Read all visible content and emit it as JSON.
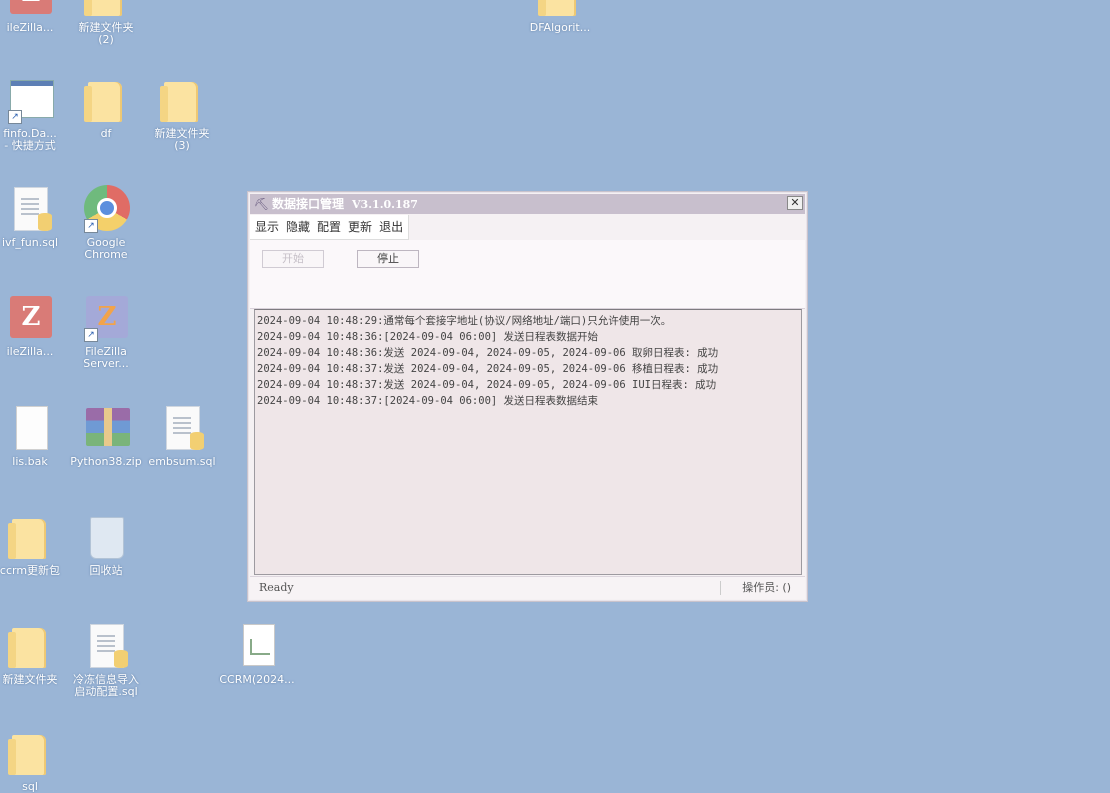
{
  "desktop": {
    "icons": [
      {
        "label": "ileZilla...",
        "type": "filezilla"
      },
      {
        "label": "新建文件夹\n(2)",
        "type": "folder"
      },
      {
        "label": "DFAlgorit...",
        "type": "folder"
      },
      {
        "label": "finfo.Da...\n- 快捷方式",
        "type": "app"
      },
      {
        "label": "df",
        "type": "folder"
      },
      {
        "label": "新建文件夹\n(3)",
        "type": "folder"
      },
      {
        "label": "ivf_fun.sql",
        "type": "sql"
      },
      {
        "label": "Google\nChrome",
        "type": "chrome"
      },
      {
        "label": "ileZilla...",
        "type": "filezilla"
      },
      {
        "label": "FileZilla\nServer...",
        "type": "filezilla-server"
      },
      {
        "label": "lis.bak",
        "type": "blank"
      },
      {
        "label": "Python38.zip",
        "type": "zip"
      },
      {
        "label": "embsum.sql",
        "type": "sql"
      },
      {
        "label": "ccrm更新包",
        "type": "folder"
      },
      {
        "label": "回收站",
        "type": "recycle"
      },
      {
        "label": "新建文件夹",
        "type": "folder"
      },
      {
        "label": "冷冻信息导入\n启动配置.sql",
        "type": "sql"
      },
      {
        "label": "CCRM(2024...",
        "type": "chart-doc"
      },
      {
        "label": "sql",
        "type": "folder"
      }
    ]
  },
  "window": {
    "title": "数据接口管理",
    "version": "V3.1.0.187",
    "close_symbol": "✕",
    "menu": [
      "显示",
      "隐藏",
      "配置",
      "更新",
      "退出"
    ],
    "buttons": {
      "start": "开始",
      "stop": "停止"
    },
    "log": [
      "2024-09-04 10:48:29:通常每个套接字地址(协议/网络地址/端口)只允许使用一次。",
      "2024-09-04 10:48:36:[2024-09-04 06:00] 发送日程表数据开始",
      "2024-09-04 10:48:36:发送 2024-09-04, 2024-09-05, 2024-09-06 取卵日程表: 成功",
      "2024-09-04 10:48:37:发送 2024-09-04, 2024-09-05, 2024-09-06 移植日程表: 成功",
      "2024-09-04 10:48:37:发送 2024-09-04, 2024-09-05, 2024-09-06 IUI日程表: 成功",
      "2024-09-04 10:48:37:[2024-09-04 06:00] 发送日程表数据结束"
    ],
    "status": {
      "left": "Ready",
      "right": "操作员: ()"
    }
  }
}
